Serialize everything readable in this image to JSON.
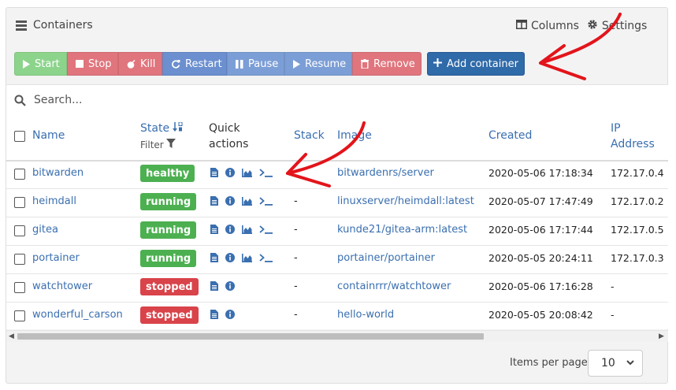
{
  "panel": {
    "title": "Containers",
    "columns_label": "Columns",
    "settings_label": "Settings"
  },
  "toolbar": {
    "start": "Start",
    "stop": "Stop",
    "kill": "Kill",
    "restart": "Restart",
    "pause": "Pause",
    "resume": "Resume",
    "remove": "Remove",
    "add": "Add container"
  },
  "search": {
    "placeholder": "Search..."
  },
  "table": {
    "headers": {
      "name": "Name",
      "state": "State",
      "filter": "Filter",
      "quick_actions_1": "Quick",
      "quick_actions_2": "actions",
      "stack": "Stack",
      "image": "Image",
      "created": "Created",
      "ip_1": "IP",
      "ip_2": "Address"
    },
    "rows": [
      {
        "name": "bitwarden",
        "state": "healthy",
        "stack": "",
        "image": "bitwardenrs/server",
        "created": "2020-05-06 17:18:34",
        "ip": "172.17.0.4"
      },
      {
        "name": "heimdall",
        "state": "running",
        "stack": "-",
        "image": "linuxserver/heimdall:latest",
        "created": "2020-05-07 17:47:49",
        "ip": "172.17.0.2"
      },
      {
        "name": "gitea",
        "state": "running",
        "stack": "-",
        "image": "kunde21/gitea-arm:latest",
        "created": "2020-05-06 17:17:44",
        "ip": "172.17.0.5"
      },
      {
        "name": "portainer",
        "state": "running",
        "stack": "-",
        "image": "portainer/portainer",
        "created": "2020-05-05 20:24:11",
        "ip": "172.17.0.3"
      },
      {
        "name": "watchtower",
        "state": "stopped",
        "stack": "-",
        "image": "containrrr/watchtower",
        "created": "2020-05-06 17:16:28",
        "ip": "-"
      },
      {
        "name": "wonderful_carson",
        "state": "stopped",
        "stack": "-",
        "image": "hello-world",
        "created": "2020-05-05 20:08:42",
        "ip": "-"
      }
    ]
  },
  "pagination": {
    "label": "Items per page",
    "value": "10"
  },
  "colors": {
    "start": "#8cd48c",
    "stop": "#e0757d",
    "kill": "#e0757d",
    "restart": "#6b8fcf",
    "pause": "#7c9ed6",
    "resume": "#7c9ed6",
    "remove": "#e0757d",
    "add": "#2f6aa9",
    "healthy": "#4cb050",
    "running": "#4cb050",
    "stopped": "#d9434a",
    "link": "#3a6fb0",
    "annotation": "#e3141b"
  }
}
